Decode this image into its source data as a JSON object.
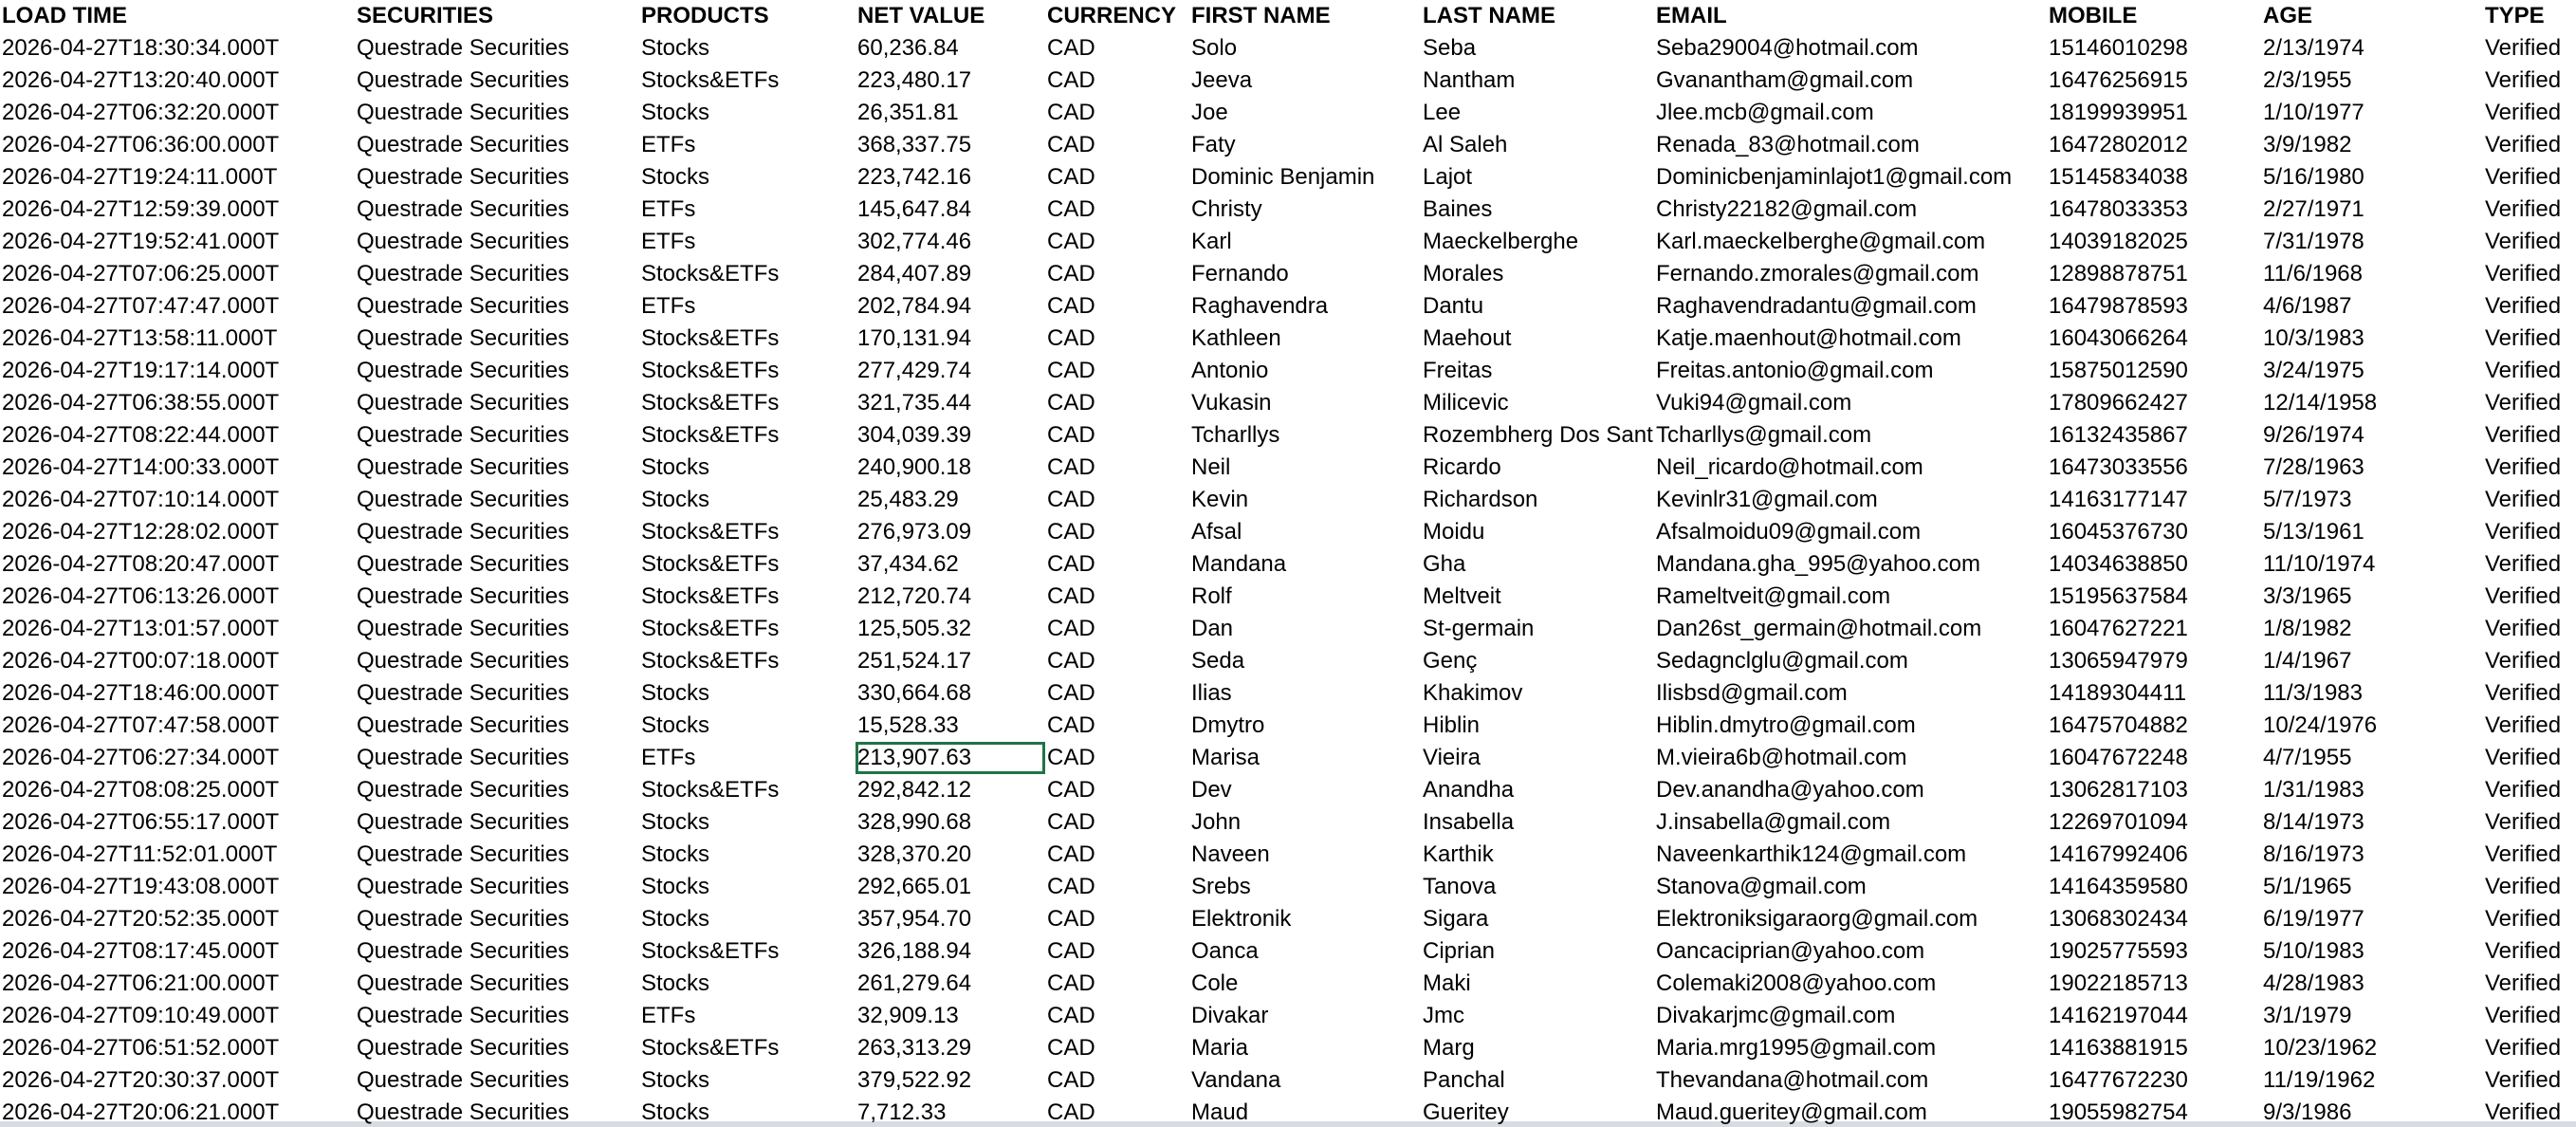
{
  "headers": [
    "LOAD TIME",
    "SECURITIES",
    "PRODUCTS",
    "NET VALUE",
    "CURRENCY",
    "FIRST NAME",
    "LAST NAME",
    "EMAIL",
    "MOBILE",
    "AGE",
    "TYPE"
  ],
  "rows": [
    [
      "2026-04-27T18:30:34.000T",
      "Questrade Securities",
      "Stocks",
      "60,236.84",
      "CAD",
      "Solo",
      "Seba",
      "Seba29004@hotmail.com",
      "15146010298",
      "2/13/1974",
      "Verified"
    ],
    [
      "2026-04-27T13:20:40.000T",
      "Questrade Securities",
      "Stocks&ETFs",
      "223,480.17",
      "CAD",
      "Jeeva",
      "Nantham",
      "Gvanantham@gmail.com",
      "16476256915",
      "2/3/1955",
      "Verified"
    ],
    [
      "2026-04-27T06:32:20.000T",
      "Questrade Securities",
      "Stocks",
      "26,351.81",
      "CAD",
      "Joe",
      "Lee",
      "Jlee.mcb@gmail.com",
      "18199939951",
      "1/10/1977",
      "Verified"
    ],
    [
      "2026-04-27T06:36:00.000T",
      "Questrade Securities",
      "ETFs",
      "368,337.75",
      "CAD",
      "Faty",
      "Al Saleh",
      "Renada_83@hotmail.com",
      "16472802012",
      "3/9/1982",
      "Verified"
    ],
    [
      "2026-04-27T19:24:11.000T",
      "Questrade Securities",
      "Stocks",
      "223,742.16",
      "CAD",
      "Dominic Benjamin",
      "Lajot",
      "Dominicbenjaminlajot1@gmail.com",
      "15145834038",
      "5/16/1980",
      "Verified"
    ],
    [
      "2026-04-27T12:59:39.000T",
      "Questrade Securities",
      "ETFs",
      "145,647.84",
      "CAD",
      "Christy",
      "Baines",
      "Christy22182@gmail.com",
      "16478033353",
      "2/27/1971",
      "Verified"
    ],
    [
      "2026-04-27T19:52:41.000T",
      "Questrade Securities",
      "ETFs",
      "302,774.46",
      "CAD",
      "Karl",
      "Maeckelberghe",
      "Karl.maeckelberghe@gmail.com",
      "14039182025",
      "7/31/1978",
      "Verified"
    ],
    [
      "2026-04-27T07:06:25.000T",
      "Questrade Securities",
      "Stocks&ETFs",
      "284,407.89",
      "CAD",
      "Fernando",
      "Morales",
      "Fernando.zmorales@gmail.com",
      "12898878751",
      "11/6/1968",
      "Verified"
    ],
    [
      "2026-04-27T07:47:47.000T",
      "Questrade Securities",
      "ETFs",
      "202,784.94",
      "CAD",
      "Raghavendra",
      "Dantu",
      "Raghavendradantu@gmail.com",
      "16479878593",
      "4/6/1987",
      "Verified"
    ],
    [
      "2026-04-27T13:58:11.000T",
      "Questrade Securities",
      "Stocks&ETFs",
      "170,131.94",
      "CAD",
      "Kathleen",
      "Maehout",
      "Katje.maenhout@hotmail.com",
      "16043066264",
      "10/3/1983",
      "Verified"
    ],
    [
      "2026-04-27T19:17:14.000T",
      "Questrade Securities",
      "Stocks&ETFs",
      "277,429.74",
      "CAD",
      "Antonio",
      "Freitas",
      "Freitas.antonio@gmail.com",
      "15875012590",
      "3/24/1975",
      "Verified"
    ],
    [
      "2026-04-27T06:38:55.000T",
      "Questrade Securities",
      "Stocks&ETFs",
      "321,735.44",
      "CAD",
      "Vukasin",
      "Milicevic",
      "Vuki94@gmail.com",
      "17809662427",
      "12/14/1958",
      "Verified"
    ],
    [
      "2026-04-27T08:22:44.000T",
      "Questrade Securities",
      "Stocks&ETFs",
      "304,039.39",
      "CAD",
      "Tcharllys",
      "Rozembherg Dos Sant",
      "Tcharllys@gmail.com",
      "16132435867",
      "9/26/1974",
      "Verified"
    ],
    [
      "2026-04-27T14:00:33.000T",
      "Questrade Securities",
      "Stocks",
      "240,900.18",
      "CAD",
      "Neil",
      "Ricardo",
      "Neil_ricardo@hotmail.com",
      "16473033556",
      "7/28/1963",
      "Verified"
    ],
    [
      "2026-04-27T07:10:14.000T",
      "Questrade Securities",
      "Stocks",
      "25,483.29",
      "CAD",
      "Kevin",
      "Richardson",
      "Kevinlr31@gmail.com",
      "14163177147",
      "5/7/1973",
      "Verified"
    ],
    [
      "2026-04-27T12:28:02.000T",
      "Questrade Securities",
      "Stocks&ETFs",
      "276,973.09",
      "CAD",
      "Afsal",
      "Moidu",
      "Afsalmoidu09@gmail.com",
      "16045376730",
      "5/13/1961",
      "Verified"
    ],
    [
      "2026-04-27T08:20:47.000T",
      "Questrade Securities",
      "Stocks&ETFs",
      "37,434.62",
      "CAD",
      "Mandana",
      "Gha",
      "Mandana.gha_995@yahoo.com",
      "14034638850",
      "11/10/1974",
      "Verified"
    ],
    [
      "2026-04-27T06:13:26.000T",
      "Questrade Securities",
      "Stocks&ETFs",
      "212,720.74",
      "CAD",
      "Rolf",
      "Meltveit",
      "Rameltveit@gmail.com",
      "15195637584",
      "3/3/1965",
      "Verified"
    ],
    [
      "2026-04-27T13:01:57.000T",
      "Questrade Securities",
      "Stocks&ETFs",
      "125,505.32",
      "CAD",
      "Dan",
      "St-germain",
      "Dan26st_germain@hotmail.com",
      "16047627221",
      "1/8/1982",
      "Verified"
    ],
    [
      "2026-04-27T00:07:18.000T",
      "Questrade Securities",
      "Stocks&ETFs",
      "251,524.17",
      "CAD",
      "Seda",
      "Genç",
      "Sedagnclglu@gmail.com",
      "13065947979",
      "1/4/1967",
      "Verified"
    ],
    [
      "2026-04-27T18:46:00.000T",
      "Questrade Securities",
      "Stocks",
      "330,664.68",
      "CAD",
      "Ilias",
      "Khakimov",
      "Ilisbsd@gmail.com",
      "14189304411",
      "11/3/1983",
      "Verified"
    ],
    [
      "2026-04-27T07:47:58.000T",
      "Questrade Securities",
      "Stocks",
      "15,528.33",
      "CAD",
      "Dmytro",
      "Hiblin",
      "Hiblin.dmytro@gmail.com",
      "16475704882",
      "10/24/1976",
      "Verified"
    ],
    [
      "2026-04-27T06:27:34.000T",
      "Questrade Securities",
      "ETFs",
      "213,907.63",
      "CAD",
      "Marisa",
      "Vieira",
      "M.vieira6b@hotmail.com",
      "16047672248",
      "4/7/1955",
      "Verified"
    ],
    [
      "2026-04-27T08:08:25.000T",
      "Questrade Securities",
      "Stocks&ETFs",
      "292,842.12",
      "CAD",
      "Dev",
      "Anandha",
      "Dev.anandha@yahoo.com",
      "13062817103",
      "1/31/1983",
      "Verified"
    ],
    [
      "2026-04-27T06:55:17.000T",
      "Questrade Securities",
      "Stocks",
      "328,990.68",
      "CAD",
      "John",
      "Insabella",
      "J.insabella@gmail.com",
      "12269701094",
      "8/14/1973",
      "Verified"
    ],
    [
      "2026-04-27T11:52:01.000T",
      "Questrade Securities",
      "Stocks",
      "328,370.20",
      "CAD",
      "Naveen",
      "Karthik",
      "Naveenkarthik124@gmail.com",
      "14167992406",
      "8/16/1973",
      "Verified"
    ],
    [
      "2026-04-27T19:43:08.000T",
      "Questrade Securities",
      "Stocks",
      "292,665.01",
      "CAD",
      "Srebs",
      "Tanova",
      "Stanova@gmail.com",
      "14164359580",
      "5/1/1965",
      "Verified"
    ],
    [
      "2026-04-27T20:52:35.000T",
      "Questrade Securities",
      "Stocks",
      "357,954.70",
      "CAD",
      "Elektronik",
      "Sigara",
      "Elektroniksigaraorg@gmail.com",
      "13068302434",
      "6/19/1977",
      "Verified"
    ],
    [
      "2026-04-27T08:17:45.000T",
      "Questrade Securities",
      "Stocks&ETFs",
      "326,188.94",
      "CAD",
      "Oanca",
      "Ciprian",
      "Oancaciprian@yahoo.com",
      "19025775593",
      "5/10/1983",
      "Verified"
    ],
    [
      "2026-04-27T06:21:00.000T",
      "Questrade Securities",
      "Stocks",
      "261,279.64",
      "CAD",
      "Cole",
      "Maki",
      "Colemaki2008@yahoo.com",
      "19022185713",
      "4/28/1983",
      "Verified"
    ],
    [
      "2026-04-27T09:10:49.000T",
      "Questrade Securities",
      "ETFs",
      "32,909.13",
      "CAD",
      "Divakar",
      "Jmc",
      "Divakarjmc@gmail.com",
      "14162197044",
      "3/1/1979",
      "Verified"
    ],
    [
      "2026-04-27T06:51:52.000T",
      "Questrade Securities",
      "Stocks&ETFs",
      "263,313.29",
      "CAD",
      "Maria",
      "Marg",
      "Maria.mrg1995@gmail.com",
      "14163881915",
      "10/23/1962",
      "Verified"
    ],
    [
      "2026-04-27T20:30:37.000T",
      "Questrade Securities",
      "Stocks",
      "379,522.92",
      "CAD",
      "Vandana",
      "Panchal",
      "Thevandana@hotmail.com",
      "16477672230",
      "11/19/1962",
      "Verified"
    ],
    [
      "2026-04-27T20:06:21.000T",
      "Questrade Securities",
      "Stocks",
      "7,712.33",
      "CAD",
      "Maud",
      "Gueritey",
      "Maud.gueritey@gmail.com",
      "19055982754",
      "9/3/1986",
      "Verified"
    ]
  ],
  "selected": {
    "row": 22,
    "col": 3
  }
}
